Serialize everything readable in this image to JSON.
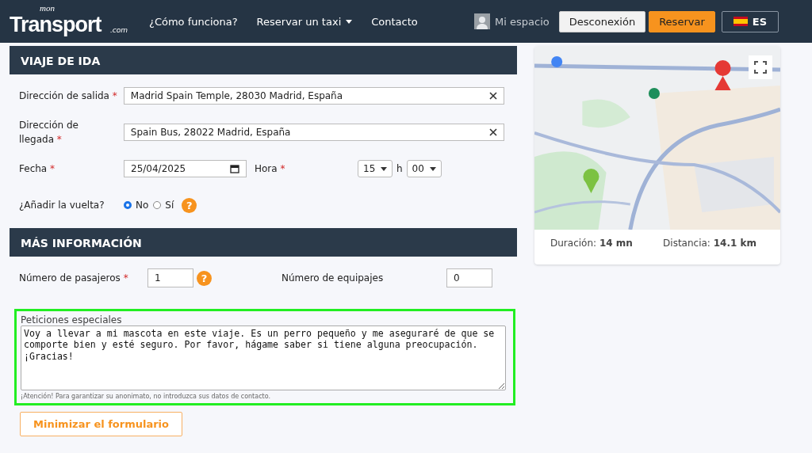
{
  "nav": {
    "logo": {
      "top": "mon",
      "main": "Transport",
      "suffix": ".com"
    },
    "links": [
      {
        "label": "¿Cómo funciona?",
        "dropdown": false
      },
      {
        "label": "Reservar un taxi",
        "dropdown": true
      },
      {
        "label": "Contacto",
        "dropdown": false
      }
    ],
    "account": "Mi espacio",
    "logout": "Desconexión",
    "book": "Reservar",
    "language": "ES"
  },
  "outbound": {
    "title": "VIAJE DE IDA",
    "departure": {
      "label": "Dirección de salida",
      "required": "*",
      "value": "Madrid Spain Temple, 28030 Madrid, España"
    },
    "arrival": {
      "label": "Dirección de llegada",
      "required": "*",
      "value": "Spain Bus, 28022 Madrid, España"
    },
    "date": {
      "label": "Fecha",
      "required": "*",
      "value": "25/04/2025"
    },
    "time": {
      "label": "Hora",
      "required": "*",
      "hour": "15",
      "separator": "h",
      "minute": "00"
    },
    "return_trip": {
      "label": "¿Añadir la vuelta?",
      "help": "?",
      "options": [
        {
          "label": "No",
          "selected": true
        },
        {
          "label": "Sí",
          "selected": false
        }
      ]
    }
  },
  "more_info": {
    "title": "MÁS INFORMACIÓN",
    "passengers": {
      "label": "Número de pasajeros",
      "required": "*",
      "value": "1",
      "help": "?"
    },
    "luggage": {
      "label": "Número de equipajes",
      "value": "0"
    }
  },
  "special_requests": {
    "highlighted": true,
    "label": "Peticiones especiales",
    "value": "Voy a llevar a mi mascota en este viaje. Es un perro pequeño y me aseguraré de que se comporte bien y esté seguro. Por favor, hágame saber si tiene alguna preocupación. ¡Gracias!",
    "notice": "¡Atención! Para garantizar su anonimato, no introduzca sus datos de contacto."
  },
  "minimize_button": "Minimizar el formulario",
  "summary": {
    "duration_label": "Duración:",
    "duration": "14 mn",
    "distance_label": "Distancia:",
    "distance": "14.1 km"
  }
}
